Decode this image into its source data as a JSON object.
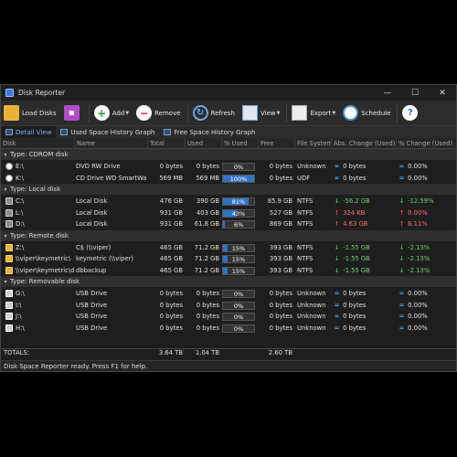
{
  "window": {
    "title": "Disk Reporter",
    "controls": {
      "minimize": "—",
      "maximize": "☐",
      "close": "✕"
    }
  },
  "toolbar": {
    "load_disks": "Load Disks",
    "add": "Add",
    "remove": "Remove",
    "refresh": "Refresh",
    "view": "View",
    "export": "Export",
    "schedule": "Schedule",
    "help": "?"
  },
  "tabs": [
    "Detail View",
    "Used Space History Graph",
    "Free Space History Graph"
  ],
  "columns": [
    "Disk",
    "Name",
    "Total",
    "Used",
    "% Used",
    "Free",
    "File System",
    "Abs. Change (Used)",
    "% Change (Used)"
  ],
  "groups": [
    {
      "label": "Type:  CDROM disk",
      "rows": [
        {
          "disk": "E:\\",
          "icon": "cdrom",
          "name": "DVD RW Drive",
          "total": "0 bytes",
          "used": "0 bytes",
          "pct": "0%",
          "pct_value": 0,
          "free": "0 bytes",
          "fs": "Unknown",
          "abs": "0 bytes",
          "abs_dir": "eq",
          "pctchg": "0.00%",
          "pctchg_dir": "eq"
        },
        {
          "disk": "K:\\",
          "icon": "cdrom",
          "name": "CD Drive WD SmartWar...",
          "total": "569 MB",
          "used": "569 MB",
          "pct": "100%",
          "pct_value": 100,
          "free": "0 bytes",
          "fs": "UDF",
          "abs": "0 bytes",
          "abs_dir": "eq",
          "pctchg": "0.00%",
          "pctchg_dir": "eq"
        }
      ]
    },
    {
      "label": "Type:  Local disk",
      "rows": [
        {
          "disk": "C:\\",
          "icon": "local",
          "name": "Local Disk",
          "total": "476 GB",
          "used": "390 GB",
          "pct": "81%",
          "pct_value": 81,
          "free": "85.9 GB",
          "fs": "NTFS",
          "abs": "-56.2 GB",
          "abs_dir": "down",
          "pctchg": "-12.59%",
          "pctchg_dir": "down"
        },
        {
          "disk": "L:\\",
          "icon": "local",
          "name": "Local Disk",
          "total": "931 GB",
          "used": "403 GB",
          "pct": "43%",
          "pct_value": 43,
          "free": "527 GB",
          "fs": "NTFS",
          "abs": "324 KB",
          "abs_dir": "up",
          "pctchg": "0.00%",
          "pctchg_dir": "up"
        },
        {
          "disk": "D:\\",
          "icon": "local",
          "name": "Local Disk",
          "total": "931 GB",
          "used": "61.8 GB",
          "pct": "6%",
          "pct_value": 6,
          "free": "869 GB",
          "fs": "NTFS",
          "abs": "4.63 GB",
          "abs_dir": "up",
          "pctchg": "8.11%",
          "pctchg_dir": "up"
        }
      ]
    },
    {
      "label": "Type:  Remote disk",
      "rows": [
        {
          "disk": "Z:\\",
          "icon": "remote",
          "name": "C$ (\\\\viper)",
          "total": "465 GB",
          "used": "71.2 GB",
          "pct": "15%",
          "pct_value": 15,
          "free": "393 GB",
          "fs": "NTFS",
          "abs": "-1.55 GB",
          "abs_dir": "down",
          "pctchg": "-2.13%",
          "pctchg_dir": "down"
        },
        {
          "disk": "\\\\viper\\keymetric\\",
          "icon": "remote",
          "name": "keymetric (\\\\viper)",
          "total": "465 GB",
          "used": "71.2 GB",
          "pct": "15%",
          "pct_value": 15,
          "free": "393 GB",
          "fs": "NTFS",
          "abs": "-1.55 GB",
          "abs_dir": "down",
          "pctchg": "-2.13%",
          "pctchg_dir": "down"
        },
        {
          "disk": "\\\\viper\\keymetric\\d...",
          "icon": "remote",
          "name": "dbbackup",
          "total": "465 GB",
          "used": "71.2 GB",
          "pct": "15%",
          "pct_value": 15,
          "free": "393 GB",
          "fs": "NTFS",
          "abs": "-1.55 GB",
          "abs_dir": "down",
          "pctchg": "-2.13%",
          "pctchg_dir": "down"
        }
      ]
    },
    {
      "label": "Type:  Removable disk",
      "rows": [
        {
          "disk": "G:\\",
          "icon": "removable",
          "name": "USB Drive",
          "total": "0 bytes",
          "used": "0 bytes",
          "pct": "0%",
          "pct_value": 0,
          "free": "0 bytes",
          "fs": "Unknown",
          "abs": "0 bytes",
          "abs_dir": "eq",
          "pctchg": "0.00%",
          "pctchg_dir": "eq"
        },
        {
          "disk": "I:\\",
          "icon": "removable",
          "name": "USB Drive",
          "total": "0 bytes",
          "used": "0 bytes",
          "pct": "0%",
          "pct_value": 0,
          "free": "0 bytes",
          "fs": "Unknown",
          "abs": "0 bytes",
          "abs_dir": "eq",
          "pctchg": "0.00%",
          "pctchg_dir": "eq"
        },
        {
          "disk": "J:\\",
          "icon": "removable",
          "name": "USB Drive",
          "total": "0 bytes",
          "used": "0 bytes",
          "pct": "0%",
          "pct_value": 0,
          "free": "0 bytes",
          "fs": "Unknown",
          "abs": "0 bytes",
          "abs_dir": "eq",
          "pctchg": "0.00%",
          "pctchg_dir": "eq"
        },
        {
          "disk": "H:\\",
          "icon": "removable",
          "name": "USB Drive",
          "total": "0 bytes",
          "used": "0 bytes",
          "pct": "0%",
          "pct_value": 0,
          "free": "0 bytes",
          "fs": "Unknown",
          "abs": "0 bytes",
          "abs_dir": "eq",
          "pctchg": "0.00%",
          "pctchg_dir": "eq"
        }
      ]
    }
  ],
  "totals": {
    "label": "TOTALS:",
    "total": "3.64 TB",
    "used": "1.04 TB",
    "free": "2.60 TB"
  },
  "status": "Disk Space Reporter ready. Press F1 for help.",
  "colors": {
    "bar_fill": "#2f73c6",
    "up_arrow": "#e04848",
    "down_arrow": "#3fbe4c",
    "tab_active": "#6fb0ff"
  }
}
